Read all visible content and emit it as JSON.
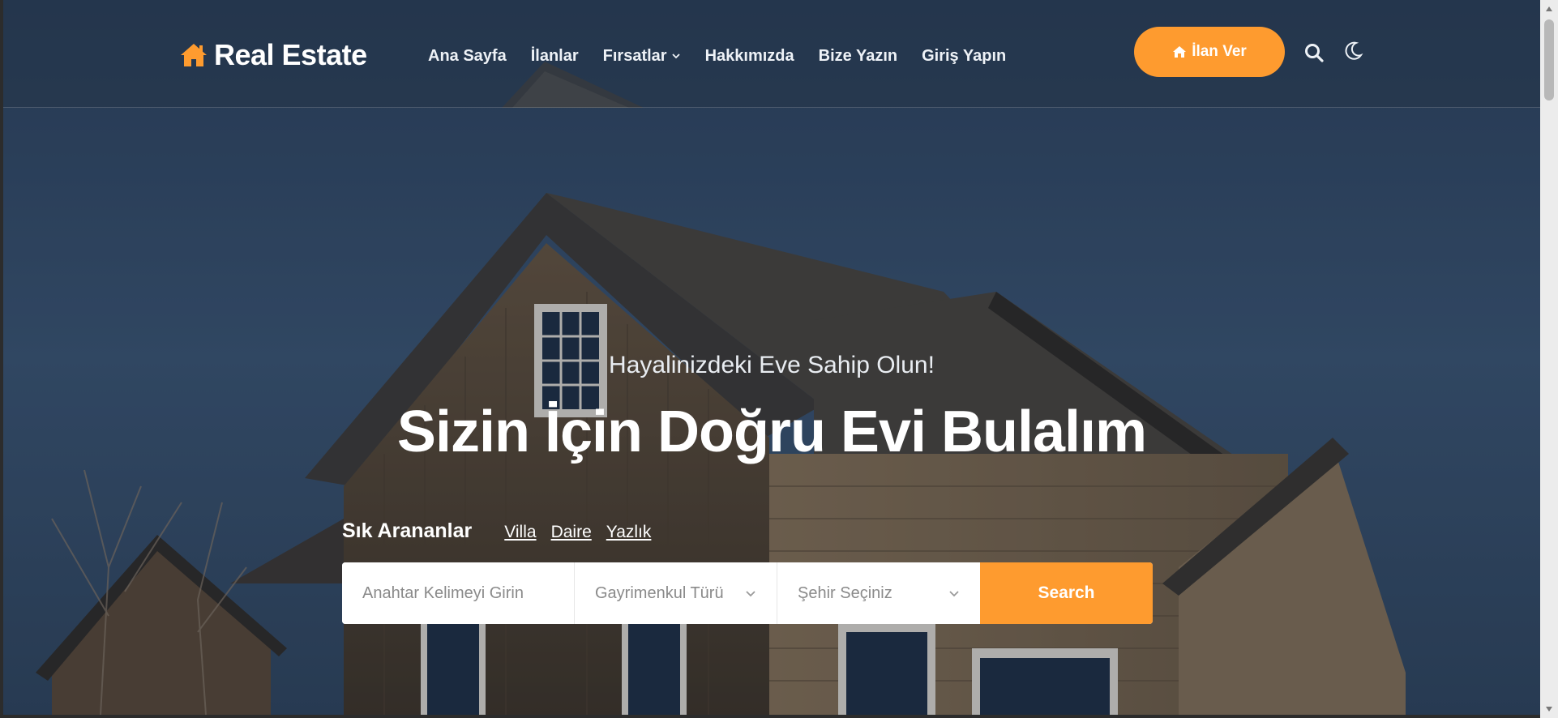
{
  "brand": {
    "name": "Real Estate",
    "icon": "home-icon",
    "accent_color": "#fe9b2f"
  },
  "nav": {
    "items": [
      {
        "label": "Ana Sayfa"
      },
      {
        "label": "İlanlar"
      },
      {
        "label": "Fırsatlar",
        "has_dropdown": true
      },
      {
        "label": "Hakkımızda"
      },
      {
        "label": "Bize Yazın"
      },
      {
        "label": "Giriş Yapın"
      }
    ]
  },
  "header": {
    "cta_label": "İlan Ver",
    "cta_icon": "home-icon",
    "search_icon": "search-icon",
    "theme_icon": "moon-icon"
  },
  "hero": {
    "subtitle": "Hayalinizdeki Eve Sahip Olun!",
    "title": "Sizin İçin Doğru Evi Bulalım"
  },
  "popular": {
    "label": "Sık Arananlar",
    "links": [
      "Villa",
      "Daire",
      "Yazlık"
    ]
  },
  "search": {
    "keyword_placeholder": "Anahtar Kelimeyi Girin",
    "property_type": "Gayrimenkul Türü",
    "city": "Şehir Seçiniz",
    "button_label": "Search"
  }
}
